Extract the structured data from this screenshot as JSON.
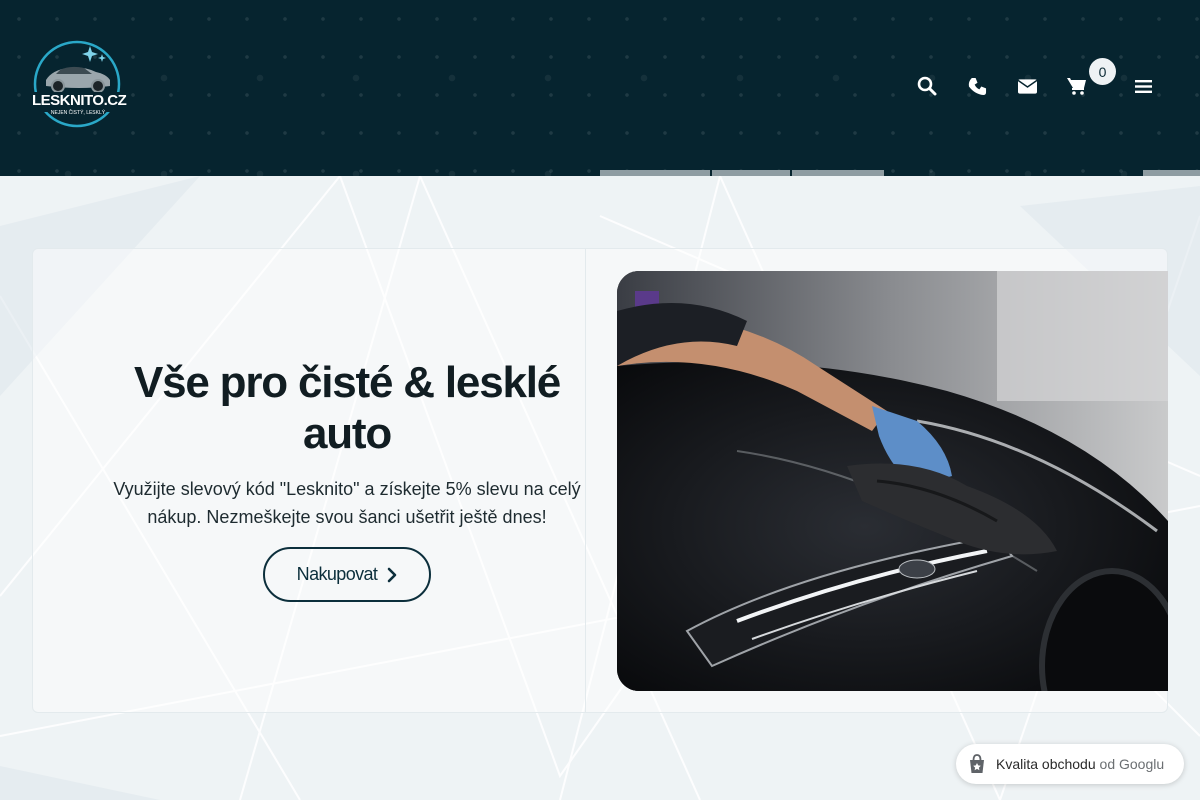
{
  "header": {
    "logo_text": "LESKNITO.CZ",
    "logo_tagline": "NEJEN ČISTÝ, LESKLÝ",
    "icons": [
      "search-icon",
      "phone-icon",
      "envelope-icon",
      "cart-icon",
      "menu-icon"
    ],
    "cart_count": "0"
  },
  "hero": {
    "title": "Vše pro čisté & lesklé auto",
    "subtitle": "Využijte slevový kód \"Lesknito\" a získejte 5% slevu na celý nákup. Nezmeškejte svou šanci ušetřit ještě dnes!",
    "cta_label": "Nakupovat",
    "image_alt": "Person in blue glove polishing a black car hood"
  },
  "google_badge": {
    "label_main": "Kvalita obchodu",
    "label_suffix": "od Googlu"
  },
  "colors": {
    "header_bg": "#06242f",
    "accent": "#0c2f3c",
    "page_bg": "#eef3f5"
  }
}
